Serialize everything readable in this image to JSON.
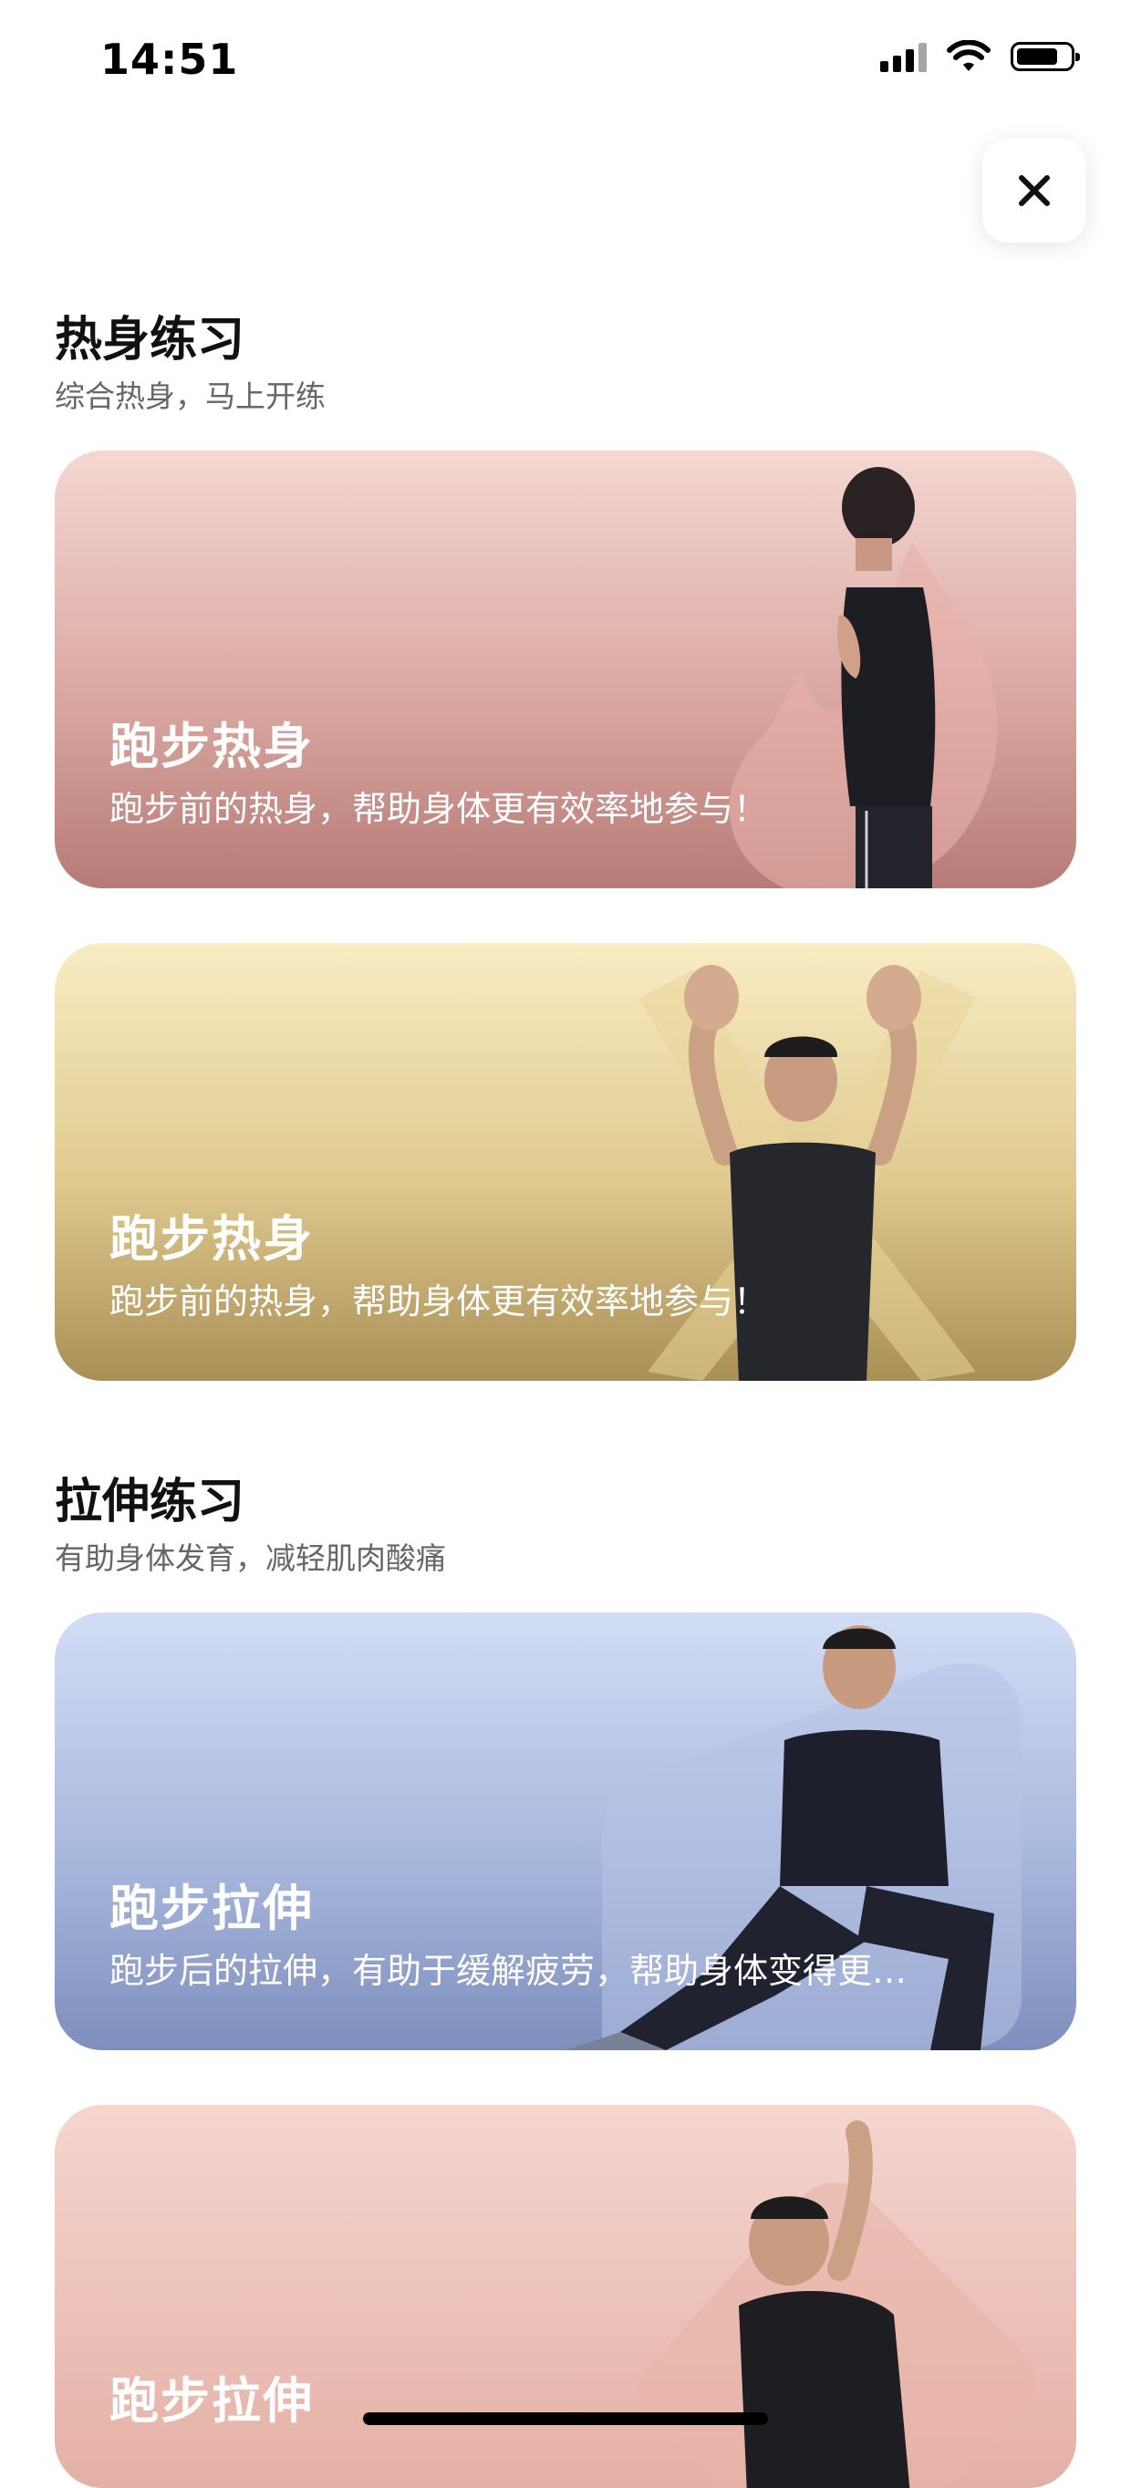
{
  "status_bar": {
    "time": "14:51"
  },
  "sections": [
    {
      "title": "热身练习",
      "subtitle": "综合热身，马上开练"
    },
    {
      "title": "拉伸练习",
      "subtitle": "有助身体发育，减轻肌肉酸痛"
    }
  ],
  "cards": [
    {
      "title": "跑步热身",
      "description": "跑步前的热身，帮助身体更有效率地参与！"
    },
    {
      "title": "跑步热身",
      "description": "跑步前的热身，帮助身体更有效率地参与！"
    },
    {
      "title": "跑步拉伸",
      "description": "跑步后的拉伸，有助于缓解疲劳，帮助身体变得更…"
    },
    {
      "title": "跑步拉伸",
      "description": ""
    }
  ],
  "icons": {
    "close": "close-icon",
    "signal": "cellular-signal-icon",
    "wifi": "wifi-icon",
    "battery": "battery-icon"
  }
}
